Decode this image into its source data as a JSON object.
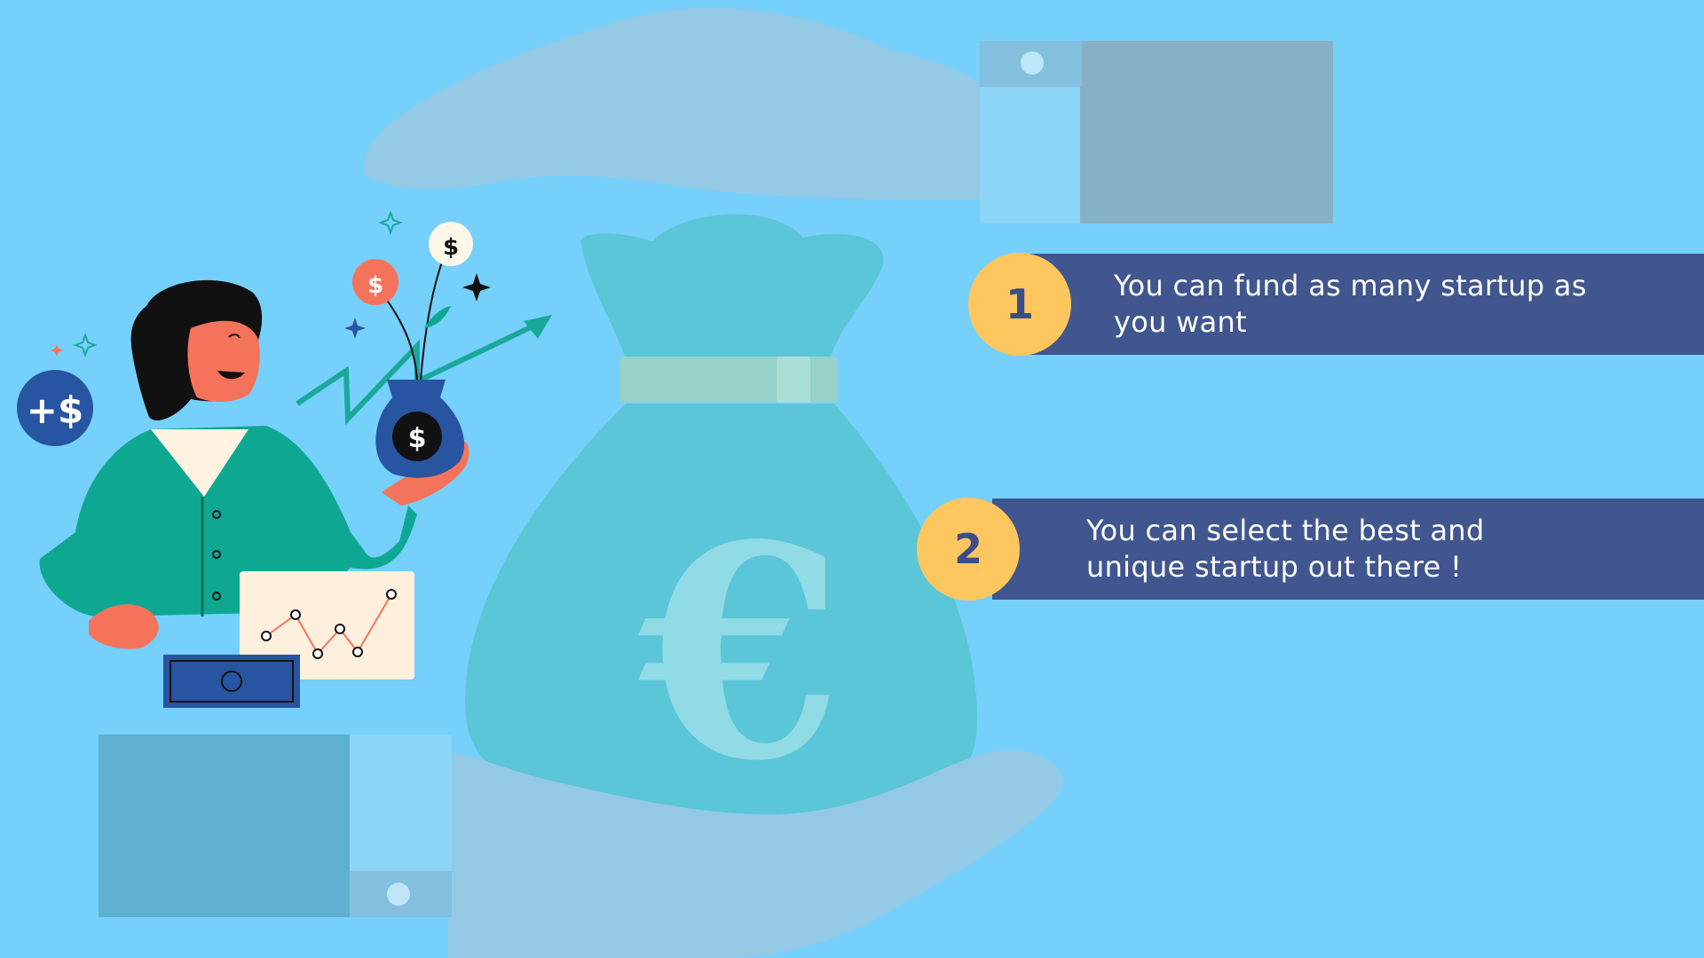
{
  "items": [
    {
      "number": "1",
      "text": "You can fund as many startup as you want"
    },
    {
      "number": "2",
      "text": "You can select the best and unique startup out there !"
    }
  ],
  "icons": {
    "bag_currency": "€",
    "coin_symbol": "$",
    "badge_symbol": "+$"
  },
  "colors": {
    "background": "#75d0fb",
    "banner": "#41568f",
    "badge": "#fdc65f",
    "badge_text": "#3c4d8a",
    "hand": "#93c9e5",
    "cuff": "#87b1c7",
    "bag": "#5bc6d7",
    "euro": "#90dbe5",
    "sweater": "#0ea892",
    "skin": "#f5735a"
  }
}
